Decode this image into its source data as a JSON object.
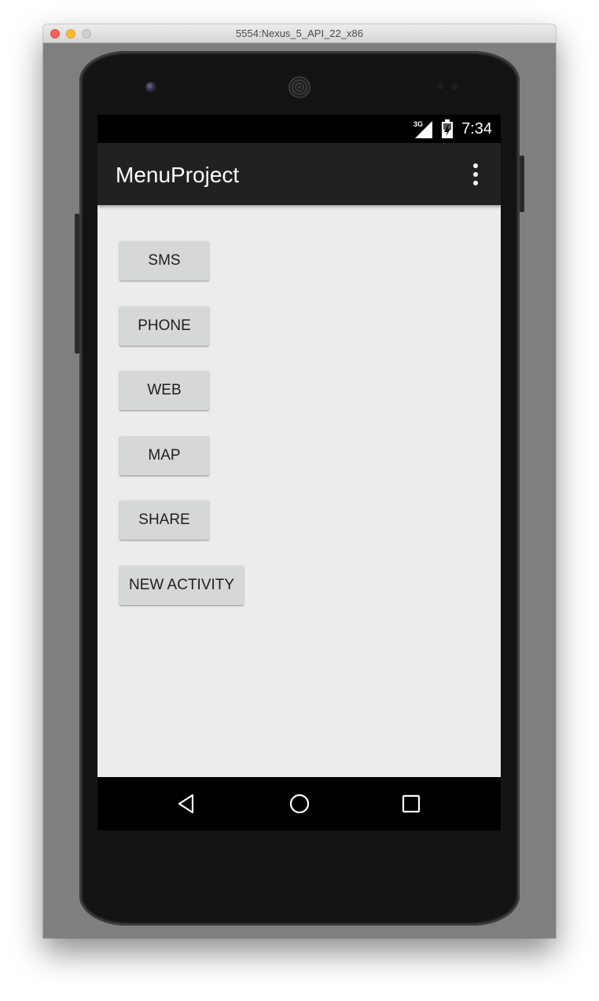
{
  "window": {
    "title": "5554:Nexus_5_API_22_x86"
  },
  "status_bar": {
    "network": "3G",
    "time": "7:34"
  },
  "app_bar": {
    "title": "MenuProject",
    "overflow_icon": "more-vert-icon"
  },
  "buttons": [
    {
      "label": "SMS"
    },
    {
      "label": "PHONE"
    },
    {
      "label": "WEB"
    },
    {
      "label": "MAP"
    },
    {
      "label": "SHARE"
    },
    {
      "label": "NEW ACTIVITY"
    }
  ],
  "nav_bar": {
    "back_icon": "back-triangle-icon",
    "home_icon": "home-circle-icon",
    "recents_icon": "recents-square-icon"
  },
  "colors": {
    "app_bar": "#212121",
    "content_background": "#ececec",
    "button": "#d6d7d7"
  }
}
